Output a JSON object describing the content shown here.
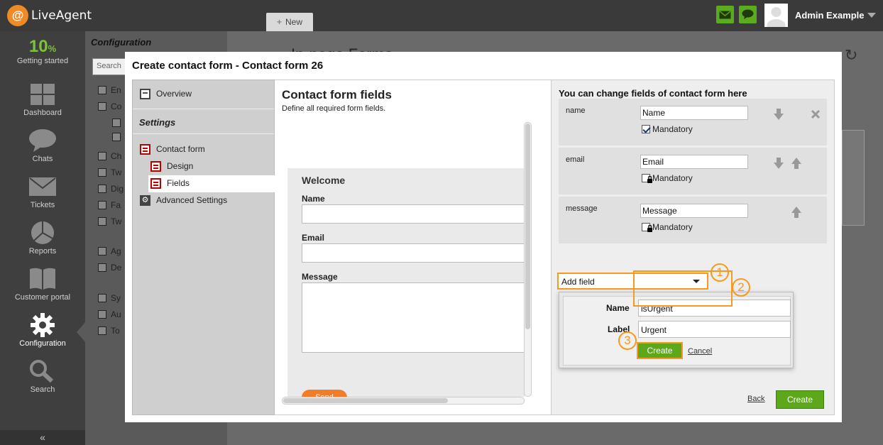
{
  "app": {
    "brand": "LiveAgent",
    "new_tab": "New",
    "user_name": "Admin Example"
  },
  "leftnav": {
    "progress_value": "10",
    "progress_unit": "%",
    "items": [
      {
        "label": "Getting started"
      },
      {
        "label": "Dashboard"
      },
      {
        "label": "Chats"
      },
      {
        "label": "Tickets"
      },
      {
        "label": "Reports"
      },
      {
        "label": "Customer portal"
      },
      {
        "label": "Configuration"
      },
      {
        "label": "Search"
      }
    ],
    "collapse": "«"
  },
  "subnav": {
    "title": "Configuration",
    "search_placeholder": "Search",
    "items": [
      "En",
      "Co",
      "",
      "",
      "Ch",
      "Tw",
      "Dig",
      "Fa",
      "Tw",
      "Ag",
      "De",
      "Sy",
      "Au",
      "To"
    ]
  },
  "background": {
    "page_title": "In-page Forms"
  },
  "modal": {
    "title": "Create contact form - Contact form 26",
    "sidebar": {
      "overview": "Overview",
      "settings": "Settings",
      "contact_form": "Contact form",
      "design": "Design",
      "fields": "Fields",
      "advanced": "Advanced Settings"
    },
    "center": {
      "title": "Contact form fields",
      "subtitle": "Define all required form fields.",
      "preview": {
        "welcome": "Welcome",
        "name_label": "Name",
        "email_label": "Email",
        "message_label": "Message",
        "send_label": "Send"
      }
    },
    "right": {
      "title": "You can change fields of contact form here",
      "fields": [
        {
          "name": "name",
          "value": "Name",
          "mandatory_label": "Mandatory",
          "mandatory": true
        },
        {
          "name": "email",
          "value": "Email",
          "mandatory_label": "Mandatory",
          "mandatory": false
        },
        {
          "name": "message",
          "value": "Message",
          "mandatory_label": "Mandatory",
          "mandatory": false
        }
      ],
      "add_field": "Add field",
      "steps": [
        "1",
        "2",
        "3"
      ],
      "popup": {
        "name_label": "Name",
        "name_value": "isUrgent",
        "label_label": "Label",
        "label_value": "Urgent",
        "create": "Create",
        "cancel": "Cancel"
      },
      "back": "Back",
      "create": "Create"
    }
  },
  "colors": {
    "accent_green": "#5ca81a",
    "highlight_orange": "#f59a1e",
    "brand_orange": "#f08a24",
    "mandatory_red": "#b00000"
  }
}
